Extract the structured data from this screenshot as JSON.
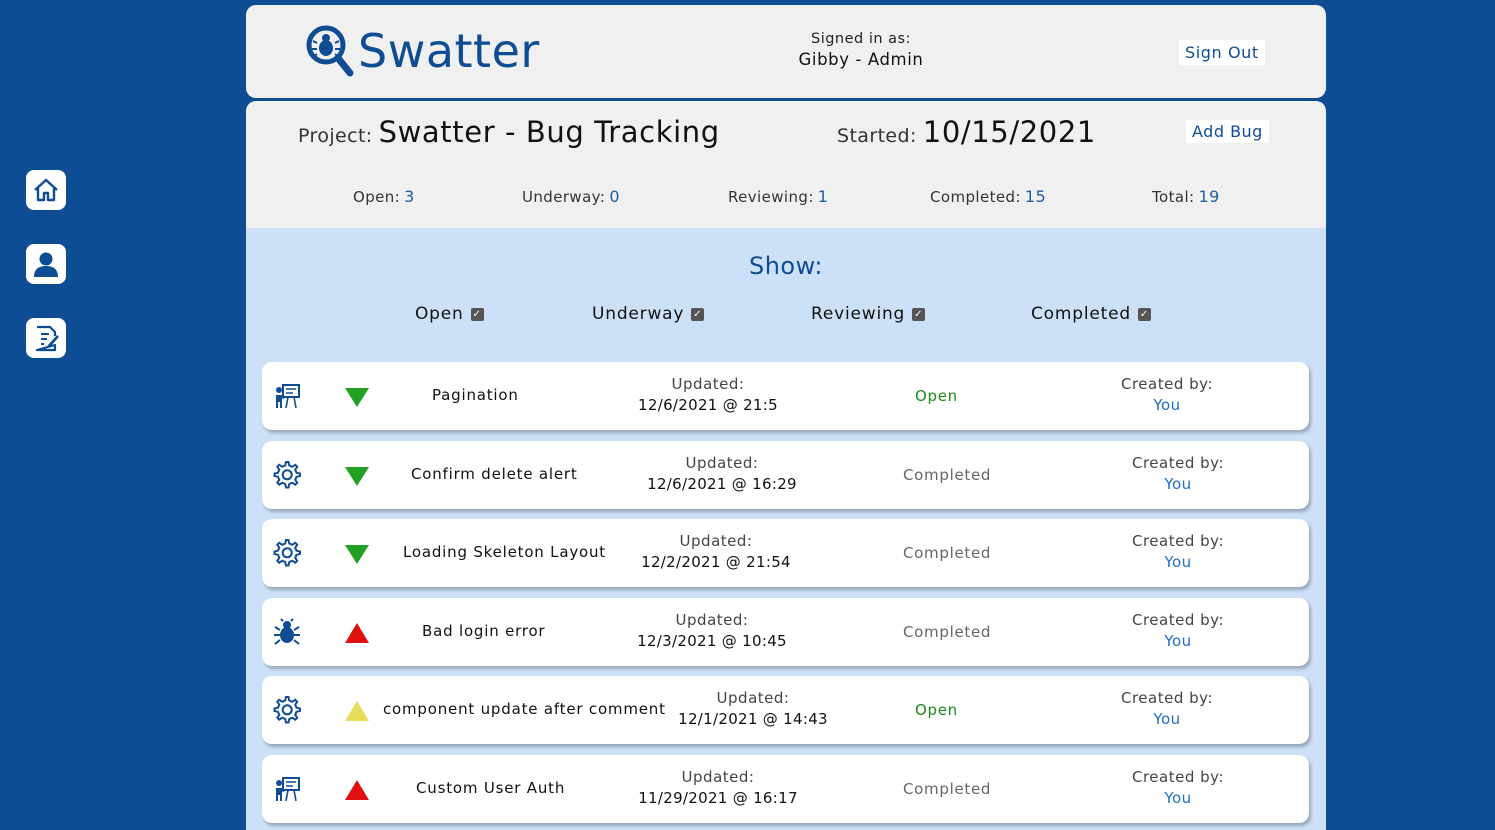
{
  "header": {
    "logo_text": "Swatter",
    "signed_in_label": "Signed in as:",
    "signed_in_user": "Gibby - Admin",
    "sign_out_label": "Sign Out"
  },
  "sidebar": {
    "items": [
      {
        "icon": "home-icon"
      },
      {
        "icon": "user-icon"
      },
      {
        "icon": "edit-document-icon"
      }
    ]
  },
  "project": {
    "project_label": "Project:",
    "project_name": "Swatter - Bug Tracking",
    "started_label": "Started:",
    "started_date": "10/15/2021",
    "add_bug_label": "Add Bug"
  },
  "stats": [
    {
      "label": "Open:",
      "value": "3"
    },
    {
      "label": "Underway:",
      "value": "0"
    },
    {
      "label": "Reviewing:",
      "value": "1"
    },
    {
      "label": "Completed:",
      "value": "15"
    },
    {
      "label": "Total:",
      "value": "19"
    }
  ],
  "filters": {
    "title": "Show:",
    "items": [
      {
        "label": "Open",
        "checked": true
      },
      {
        "label": "Underway",
        "checked": true
      },
      {
        "label": "Reviewing",
        "checked": true
      },
      {
        "label": "Completed",
        "checked": true
      }
    ]
  },
  "bugs": [
    {
      "category_icon": "presentation-icon",
      "priority": "low",
      "priority_color": "#22a022",
      "title": "Pagination",
      "updated_label": "Updated:",
      "updated": "12/6/2021 @ 21:5",
      "status": "Open",
      "status_color": "#1a8a1a",
      "created_label": "Created by:",
      "created_by": "You"
    },
    {
      "category_icon": "gear-icon",
      "priority": "low",
      "priority_color": "#22a022",
      "title": "Confirm delete alert",
      "updated_label": "Updated:",
      "updated": "12/6/2021 @ 16:29",
      "status": "Completed",
      "status_color": "#666666",
      "created_label": "Created by:",
      "created_by": "You"
    },
    {
      "category_icon": "gear-icon",
      "priority": "low",
      "priority_color": "#22a022",
      "title": "Loading Skeleton Layout",
      "updated_label": "Updated:",
      "updated": "12/2/2021 @ 21:54",
      "status": "Completed",
      "status_color": "#666666",
      "created_label": "Created by:",
      "created_by": "You"
    },
    {
      "category_icon": "bug-icon",
      "priority": "high",
      "priority_color": "#e01010",
      "title": "Bad login error",
      "updated_label": "Updated:",
      "updated": "12/3/2021 @ 10:45",
      "status": "Completed",
      "status_color": "#666666",
      "created_label": "Created by:",
      "created_by": "You"
    },
    {
      "category_icon": "gear-icon",
      "priority": "medium",
      "priority_color": "#e6dc5a",
      "title": "component update after comment",
      "updated_label": "Updated:",
      "updated": "12/1/2021 @ 14:43",
      "status": "Open",
      "status_color": "#1a8a1a",
      "created_label": "Created by:",
      "created_by": "You"
    },
    {
      "category_icon": "presentation-icon",
      "priority": "high",
      "priority_color": "#e01010",
      "title": "Custom User Auth",
      "updated_label": "Updated:",
      "updated": "11/29/2021 @ 16:17",
      "status": "Completed",
      "status_color": "#666666",
      "created_label": "Created by:",
      "created_by": "You"
    }
  ]
}
